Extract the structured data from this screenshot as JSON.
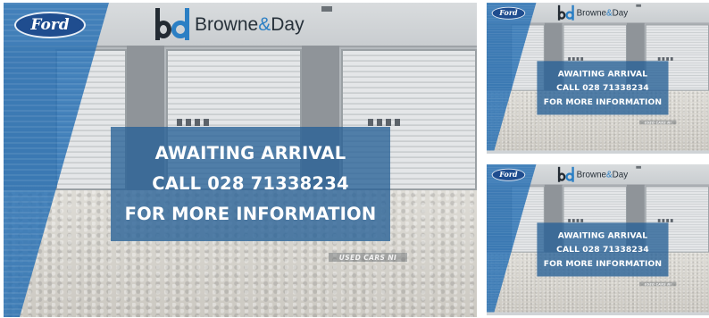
{
  "gallery": {
    "main_image": {
      "dealer_logo": {
        "name": "Browne",
        "ampersand": "&",
        "name_end": "Day"
      },
      "brand_logo": "Ford",
      "notice": {
        "line1": "AWAITING ARRIVAL",
        "line2": "CALL 028 71338234",
        "line3": "FOR MORE INFORMATION"
      },
      "watermark": "USED CARS NI"
    },
    "thumbnails": [
      {
        "dealer_logo": {
          "name": "Browne",
          "ampersand": "&",
          "name_end": "Day"
        },
        "brand_logo": "Ford",
        "notice": {
          "line1": "AWAITING ARRIVAL",
          "line2": "CALL 028 71338234",
          "line3": "FOR MORE INFORMATION"
        },
        "watermark": "USED CARS NI"
      },
      {
        "dealer_logo": {
          "name": "Browne",
          "ampersand": "&",
          "name_end": "Day"
        },
        "brand_logo": "Ford",
        "notice": {
          "line1": "AWAITING ARRIVAL",
          "line2": "CALL 028 71338234",
          "line3": "FOR MORE INFORMATION"
        },
        "watermark": "USED CARS NI"
      }
    ]
  },
  "colors": {
    "brand_blue": "#226cb2",
    "notice_bg": "#266096",
    "ford_blue": "#1f4d8f",
    "logo_dark": "#232b33",
    "logo_blue": "#2b7fc4"
  }
}
